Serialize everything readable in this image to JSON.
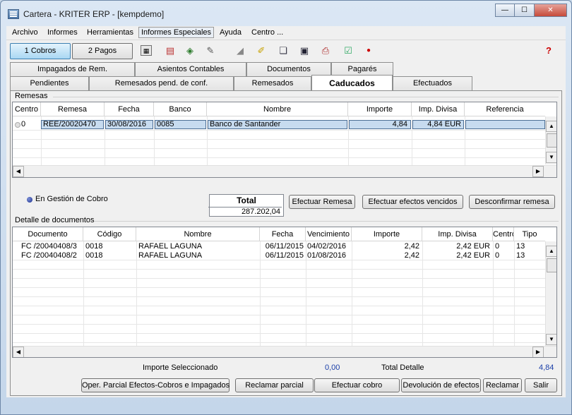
{
  "window": {
    "title": "Cartera - KRITER ERP - [kempdemo]",
    "minimize": "—",
    "maximize": "☐",
    "close": "✕"
  },
  "menu": [
    "Archivo",
    "Informes",
    "Herramientas",
    "Informes Especiales",
    "Ayuda",
    "Centro ..."
  ],
  "toolbar": {
    "cobros_label": "1 Cobros",
    "pagos_label": "2 Pagos",
    "icons": [
      "calculator-icon",
      "calendar-icon",
      "money-icon",
      "note-edit-icon",
      "eraser-icon",
      "highlighter-icon",
      "documents-icon",
      "ledger-icon",
      "printer-icon",
      "checklist-icon",
      "red-dot-icon",
      "help-icon"
    ]
  },
  "tabs_row1": [
    "Impagados de Rem.",
    "Asientos Contables",
    "Documentos",
    "Pagarés"
  ],
  "tabs_row2": [
    "Pendientes",
    "Remesados pend. de conf.",
    "Remesados",
    "Caducados",
    "Efectuados"
  ],
  "active_tab": "Caducados",
  "remesas": {
    "label": "Remesas",
    "columns": [
      "Centro",
      "Remesa",
      "Fecha",
      "Banco",
      "Nombre",
      "Importe",
      "Imp. Divisa",
      "Referencia"
    ],
    "rows": [
      {
        "centro": "0",
        "remesa": "REE/20020470",
        "fecha": "30/08/2016",
        "banco": "0085",
        "nombre": "Banco de Santander",
        "importe": "4,84",
        "imp_divisa": "4,84 EUR",
        "referencia": ""
      }
    ]
  },
  "gestion": {
    "label": "En Gestión de Cobro",
    "total_label": "Total",
    "total_value": "287.202,04"
  },
  "remesa_buttons": {
    "efectuar_remesa": "Efectuar Remesa",
    "efectuar_vencidos": "Efectuar efectos vencidos",
    "desconfirmar": "Desconfirmar remesa"
  },
  "detalle": {
    "label": "Detalle de documentos",
    "columns": [
      "Documento",
      "Código",
      "Nombre",
      "Fecha",
      "Vencimiento",
      "Importe",
      "Imp. Divisa",
      "Centro",
      "Tipo"
    ],
    "rows": [
      {
        "documento": "FC /20040408/3",
        "codigo": "0018",
        "nombre": "RAFAEL LAGUNA",
        "fecha": "06/11/2015",
        "vencimiento": "04/02/2016",
        "importe": "2,42",
        "imp_divisa": "2,42 EUR",
        "centro": "0",
        "tipo": "13"
      },
      {
        "documento": "FC /20040408/2",
        "codigo": "0018",
        "nombre": "RAFAEL LAGUNA",
        "fecha": "06/11/2015",
        "vencimiento": "01/08/2016",
        "importe": "2,42",
        "imp_divisa": "2,42 EUR",
        "centro": "0",
        "tipo": "13"
      }
    ]
  },
  "footer": {
    "importe_sel_label": "Importe Seleccionado",
    "importe_sel_value": "0,00",
    "total_detalle_label": "Total Detalle",
    "total_detalle_value": "4,84"
  },
  "bottom_buttons": {
    "oper_parcial": "Oper. Parcial Efectos-Cobros e Impagados",
    "reclamar_parcial": "Reclamar parcial",
    "efectuar_cobro": "Efectuar cobro",
    "devolucion": "Devolución de efectos",
    "reclamar": "Reclamar",
    "salir": "Salir"
  }
}
